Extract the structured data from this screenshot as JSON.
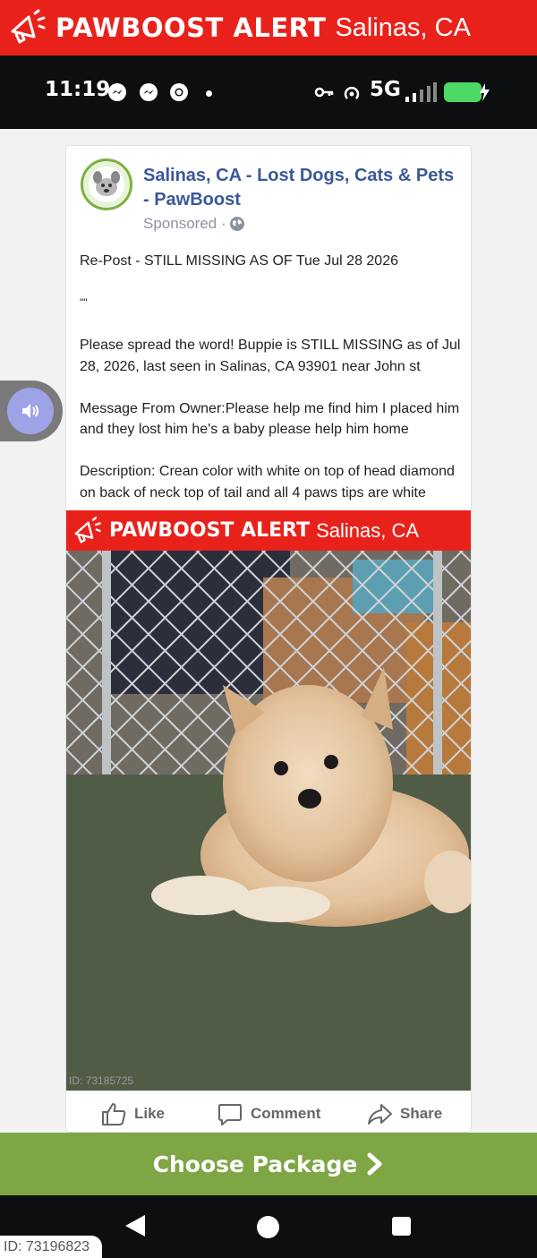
{
  "alert_banner": {
    "brand": "PAWBOOST ALERT",
    "location": "Salinas, CA",
    "icon": "megaphone-icon"
  },
  "status_bar": {
    "time": "11:19",
    "left_icons": [
      "messenger-icon",
      "messenger-icon",
      "chrome-icon"
    ],
    "right_icons": [
      "key-icon",
      "hotspot-icon",
      "signal-icon",
      "battery-charging-icon"
    ],
    "network": "5G"
  },
  "post": {
    "page_name": "Salinas, CA - Lost Dogs, Cats & Pets - PawBoost",
    "sponsored_label": "Sponsored ·",
    "repost_line": "Re-Post - STILL MISSING AS OF Tue Jul 28 2026",
    "quote_line": "\"\"",
    "spread_line": "Please spread the word! Buppie is STILL MISSING as of Jul 28, 2026, last seen in Salinas, CA 93901 near John st",
    "owner_message": "Message From Owner:Please help me find him I placed him and they lost him he's a baby please help him home",
    "description": "Description: Crean color with white on top of head diamond on back of neck top of tail and all 4 paws tips are white",
    "image_banner": {
      "brand": "PAWBOOST ALERT",
      "location": "Salinas, CA"
    },
    "image_id": "ID: 73185725",
    "actions": {
      "like": "Like",
      "comment": "Comment",
      "share": "Share"
    }
  },
  "choose_package": {
    "label": "Choose Package"
  },
  "bottom_id": "ID: 73196823",
  "colors": {
    "alert_red": "#e8221b",
    "fb_blue": "#3b5998",
    "green": "#7fa645",
    "dark": "#0c0e0f"
  }
}
